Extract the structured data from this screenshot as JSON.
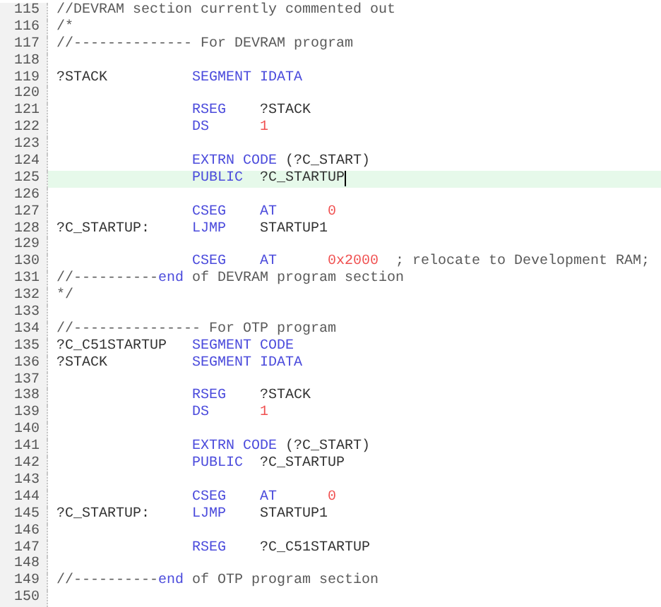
{
  "lines": [
    {
      "number": "115",
      "current": false,
      "text": [
        {
          "text": "//DEVRAM section currently commented out",
          "kind": "comment"
        }
      ]
    },
    {
      "number": "116",
      "current": false,
      "text": [
        {
          "text": "/*",
          "kind": "comment"
        }
      ]
    },
    {
      "number": "117",
      "current": false,
      "text": [
        {
          "text": "//-------------- For DEVRAM program",
          "kind": "comment"
        }
      ]
    },
    {
      "number": "118",
      "current": false
    },
    {
      "number": "119",
      "current": false,
      "label": "?STACK",
      "op": "SEGMENT",
      "args": [
        {
          "text": "IDATA",
          "kind": "keyword"
        }
      ]
    },
    {
      "number": "120",
      "current": false
    },
    {
      "number": "121",
      "current": false,
      "op": "RSEG",
      "args": [
        {
          "text": "?STACK",
          "kind": "plain"
        }
      ]
    },
    {
      "number": "122",
      "current": false,
      "op": "DS",
      "args": [
        {
          "text": "1",
          "kind": "number"
        }
      ]
    },
    {
      "number": "123",
      "current": false
    },
    {
      "number": "124",
      "current": false,
      "op": "EXTRN CODE",
      "args": [
        {
          "text": "(?C_START)",
          "kind": "plain"
        }
      ]
    },
    {
      "number": "125",
      "current": true,
      "op": "PUBLIC",
      "args": [
        {
          "text": "?C_STARTUP",
          "kind": "plain"
        }
      ]
    },
    {
      "number": "126",
      "current": false
    },
    {
      "number": "127",
      "current": false,
      "op": "CSEG",
      "args": [
        {
          "text": "AT",
          "kind": "keyword"
        },
        {
          "text": "0",
          "kind": "number"
        }
      ]
    },
    {
      "number": "128",
      "current": false,
      "label": "?C_STARTUP:",
      "op": "LJMP",
      "args": [
        {
          "text": "STARTUP1",
          "kind": "plain"
        }
      ]
    },
    {
      "number": "129",
      "current": false
    },
    {
      "number": "130",
      "current": false,
      "op": "CSEG",
      "args": [
        {
          "text": "AT",
          "kind": "keyword"
        },
        {
          "text": "0x2000",
          "kind": "number"
        },
        {
          "text": "; relocate to Development RAM;",
          "kind": "comment"
        }
      ]
    },
    {
      "number": "131",
      "current": false,
      "text": [
        {
          "text": "//----------",
          "kind": "comment"
        },
        {
          "text": "end",
          "kind": "keyword"
        },
        {
          "text": " of DEVRAM program section",
          "kind": "comment"
        }
      ]
    },
    {
      "number": "132",
      "current": false,
      "text": [
        {
          "text": "*/",
          "kind": "comment"
        }
      ]
    },
    {
      "number": "133",
      "current": false
    },
    {
      "number": "134",
      "current": false,
      "text": [
        {
          "text": "//--------------- For OTP program",
          "kind": "comment"
        }
      ]
    },
    {
      "number": "135",
      "current": false,
      "label": "?C_C51STARTUP",
      "op": "SEGMENT",
      "args": [
        {
          "text": "CODE",
          "kind": "keyword"
        }
      ]
    },
    {
      "number": "136",
      "current": false,
      "label": "?STACK",
      "op": "SEGMENT",
      "args": [
        {
          "text": "IDATA",
          "kind": "keyword"
        }
      ]
    },
    {
      "number": "137",
      "current": false
    },
    {
      "number": "138",
      "current": false,
      "op": "RSEG",
      "args": [
        {
          "text": "?STACK",
          "kind": "plain"
        }
      ]
    },
    {
      "number": "139",
      "current": false,
      "op": "DS",
      "args": [
        {
          "text": "1",
          "kind": "number"
        }
      ]
    },
    {
      "number": "140",
      "current": false
    },
    {
      "number": "141",
      "current": false,
      "op": "EXTRN CODE",
      "args": [
        {
          "text": "(?C_START)",
          "kind": "plain"
        }
      ]
    },
    {
      "number": "142",
      "current": false,
      "op": "PUBLIC",
      "args": [
        {
          "text": "?C_STARTUP",
          "kind": "plain"
        }
      ]
    },
    {
      "number": "143",
      "current": false
    },
    {
      "number": "144",
      "current": false,
      "op": "CSEG",
      "args": [
        {
          "text": "AT",
          "kind": "keyword"
        },
        {
          "text": "0",
          "kind": "number"
        }
      ]
    },
    {
      "number": "145",
      "current": false,
      "label": "?C_STARTUP:",
      "op": "LJMP",
      "args": [
        {
          "text": "STARTUP1",
          "kind": "plain"
        }
      ]
    },
    {
      "number": "146",
      "current": false
    },
    {
      "number": "147",
      "current": false,
      "op": "RSEG",
      "args": [
        {
          "text": "?C_C51STARTUP",
          "kind": "plain"
        }
      ]
    },
    {
      "number": "148",
      "current": false
    },
    {
      "number": "149",
      "current": false,
      "text": [
        {
          "text": "//----------",
          "kind": "comment"
        },
        {
          "text": "end",
          "kind": "keyword"
        },
        {
          "text": " of OTP program section",
          "kind": "comment"
        }
      ]
    },
    {
      "number": "150",
      "current": false
    }
  ]
}
